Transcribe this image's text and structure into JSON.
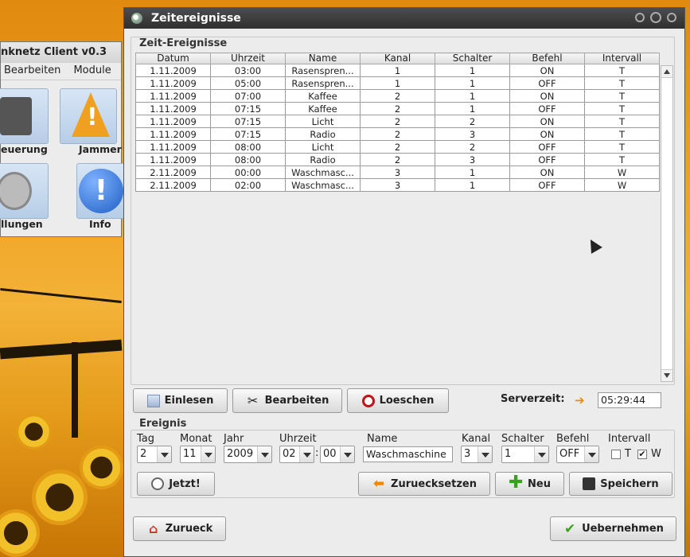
{
  "bg_window": {
    "title": "nknetz Client v0.3",
    "menu": [
      "Bearbeiten",
      "Module"
    ],
    "tiles": [
      "euerung",
      "Jammer",
      "llungen",
      "Info"
    ]
  },
  "window": {
    "title": "Zeitereignisse"
  },
  "events_group": {
    "label": "Zeit-Ereignisse",
    "columns": [
      "Datum",
      "Uhrzeit",
      "Name",
      "Kanal",
      "Schalter",
      "Befehl",
      "Intervall"
    ],
    "rows": [
      [
        "1.11.2009",
        "03:00",
        "Rasenspren...",
        "1",
        "1",
        "ON",
        "T"
      ],
      [
        "1.11.2009",
        "05:00",
        "Rasenspren...",
        "1",
        "1",
        "OFF",
        "T"
      ],
      [
        "1.11.2009",
        "07:00",
        "Kaffee",
        "2",
        "1",
        "ON",
        "T"
      ],
      [
        "1.11.2009",
        "07:15",
        "Kaffee",
        "2",
        "1",
        "OFF",
        "T"
      ],
      [
        "1.11.2009",
        "07:15",
        "Licht",
        "2",
        "2",
        "ON",
        "T"
      ],
      [
        "1.11.2009",
        "07:15",
        "Radio",
        "2",
        "3",
        "ON",
        "T"
      ],
      [
        "1.11.2009",
        "08:00",
        "Licht",
        "2",
        "2",
        "OFF",
        "T"
      ],
      [
        "1.11.2009",
        "08:00",
        "Radio",
        "2",
        "3",
        "OFF",
        "T"
      ],
      [
        "2.11.2009",
        "00:00",
        "Waschmasc...",
        "3",
        "1",
        "ON",
        "W"
      ],
      [
        "2.11.2009",
        "02:00",
        "Waschmasc...",
        "3",
        "1",
        "OFF",
        "W"
      ]
    ]
  },
  "actions": {
    "read": "Einlesen",
    "edit": "Bearbeiten",
    "delete": "Loeschen",
    "server_time_label": "Serverzeit:",
    "server_time": "05:29:44"
  },
  "event_form": {
    "label": "Ereignis",
    "day_label": "Tag",
    "day": "2",
    "month_label": "Monat",
    "month": "11",
    "year_label": "Jahr",
    "year": "2009",
    "time_label": "Uhrzeit",
    "hour": "02",
    "colon": ":",
    "minute": "00",
    "name_label": "Name",
    "name": "Waschmaschine",
    "channel_label": "Kanal",
    "channel": "3",
    "switch_label": "Schalter",
    "switch": "1",
    "command_label": "Befehl",
    "command": "OFF",
    "interval_label": "Intervall",
    "interval_t": "T",
    "interval_w": "W",
    "interval_t_checked": false,
    "interval_w_checked": true,
    "now_button": "Jetzt!",
    "reset_button": "Zuruecksetzen",
    "new_button": "Neu",
    "save_button": "Speichern"
  },
  "footer": {
    "back_button": "Zurueck",
    "apply_button": "Uebernehmen"
  }
}
